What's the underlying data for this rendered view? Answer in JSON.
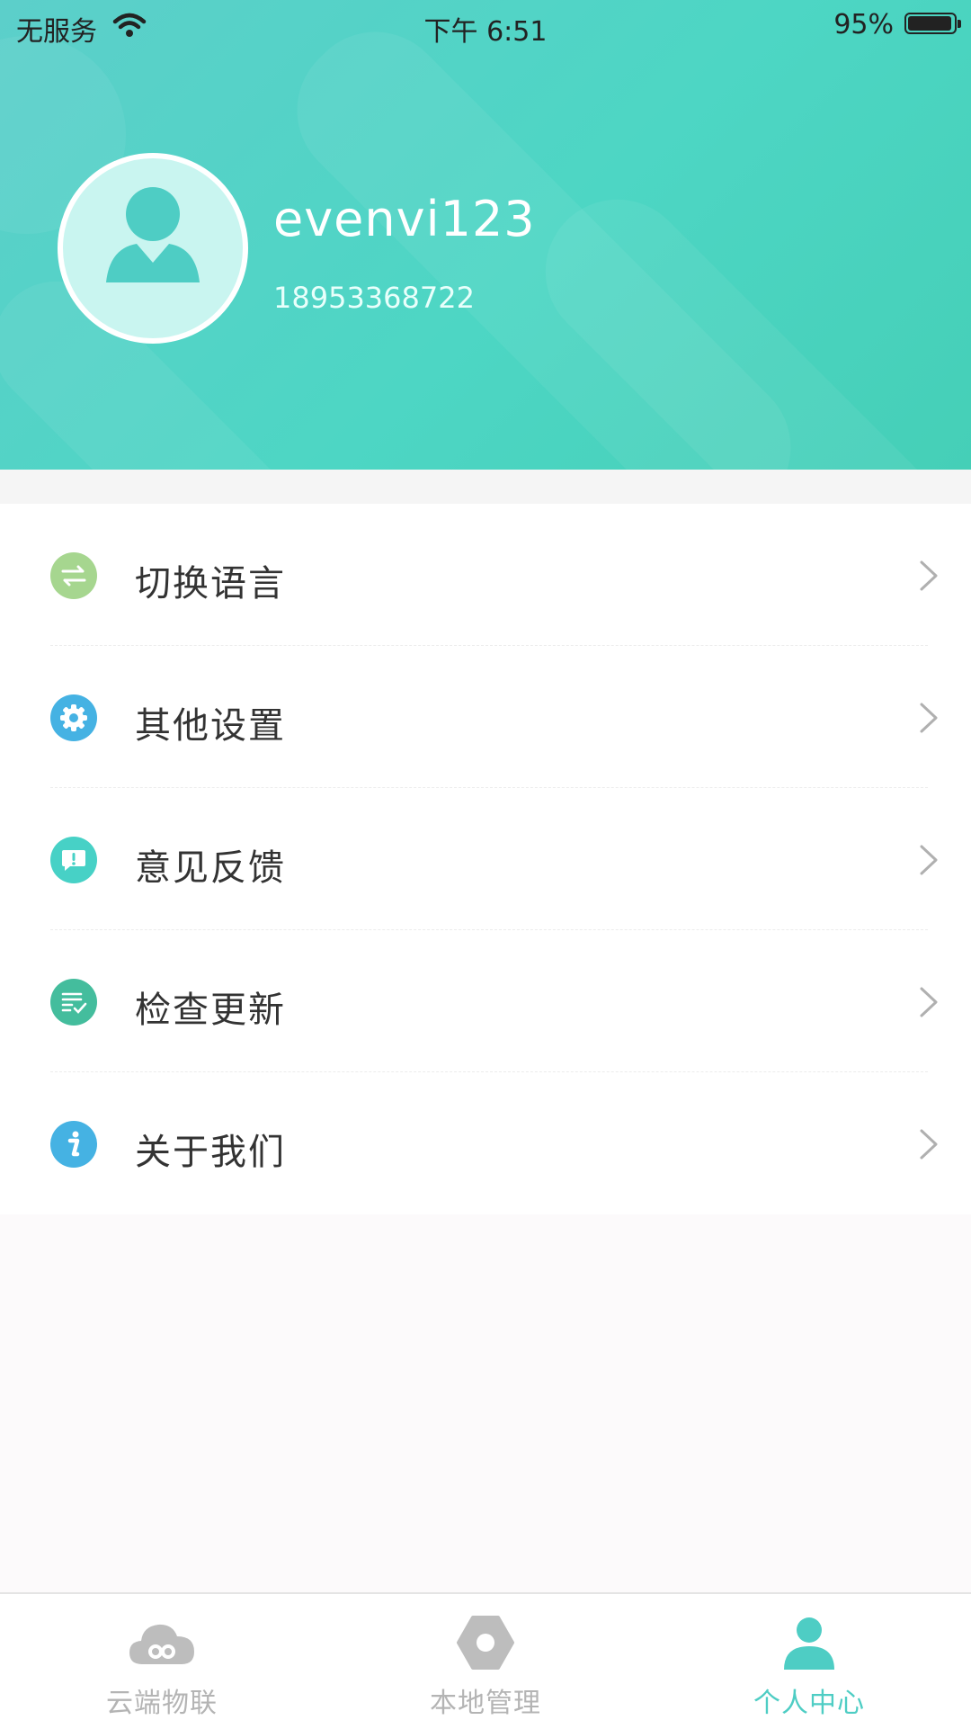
{
  "status_bar": {
    "carrier": "无服务",
    "time": "下午 6:51",
    "battery_percent": "95%",
    "battery_level": 0.95
  },
  "profile": {
    "username": "evenvi123",
    "phone": "18953368722"
  },
  "menu": {
    "items": [
      {
        "label": "切换语言",
        "icon": "swap-icon",
        "color": "#a6d68f"
      },
      {
        "label": "其他设置",
        "icon": "gear-icon",
        "color": "#45b2e3"
      },
      {
        "label": "意见反馈",
        "icon": "feedback-icon",
        "color": "#47d1c6"
      },
      {
        "label": "检查更新",
        "icon": "checklist-icon",
        "color": "#44bd9d"
      },
      {
        "label": "关于我们",
        "icon": "info-icon",
        "color": "#45b2e3"
      }
    ]
  },
  "tabbar": {
    "tabs": [
      {
        "label": "云端物联",
        "icon": "cloud-icon",
        "active": false
      },
      {
        "label": "本地管理",
        "icon": "hexagon-icon",
        "active": false
      },
      {
        "label": "个人中心",
        "icon": "person-icon",
        "active": true
      }
    ]
  },
  "colors": {
    "accent": "#4ecdc4",
    "inactive": "#b4b4b4",
    "header_start": "#5ccfca",
    "header_end": "#45cfb7"
  }
}
